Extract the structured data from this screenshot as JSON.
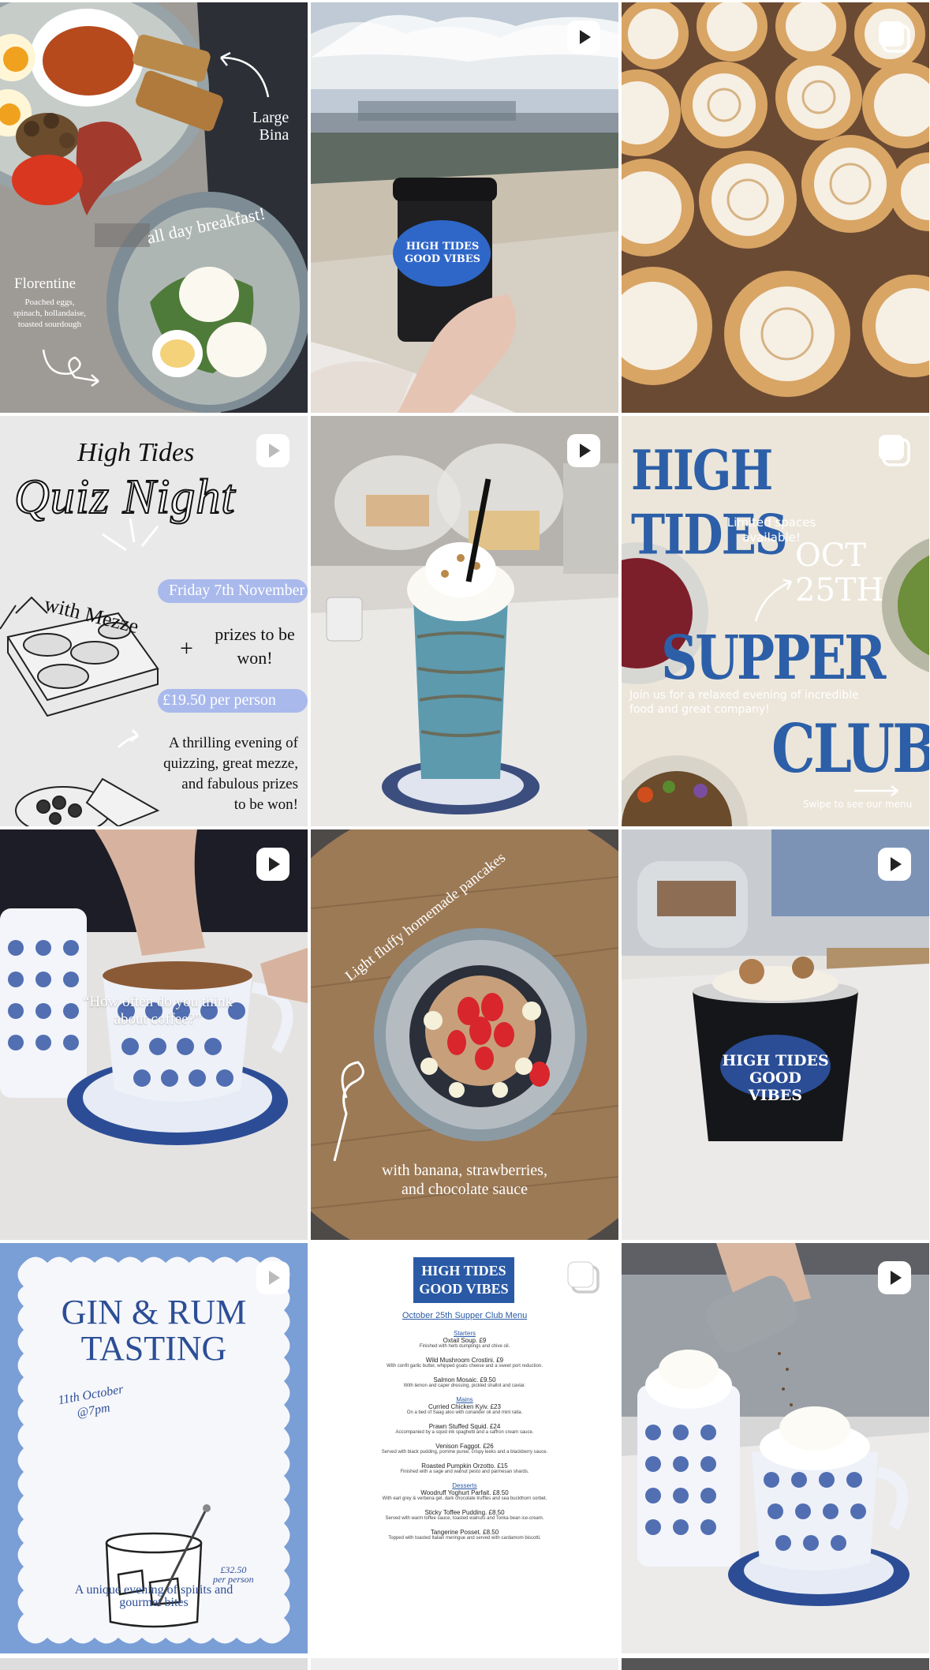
{
  "colors": {
    "brand_blue": "#2c5fa8",
    "cream": "#efe8dc",
    "quiz_bg": "#e9e9e9",
    "gin_bg": "#7a9ed6"
  },
  "posts": [
    {
      "id": "breakfast",
      "type": "carousel-none",
      "texts": {
        "large": "Large",
        "bina": "Bina",
        "all_day": "all day breakfast!",
        "florentine": "Florentine",
        "desc1": "Poached eggs,",
        "desc2": "spinach, hollandaise,",
        "desc3": "toasted sourdough"
      }
    },
    {
      "id": "coffee-cup",
      "type": "reel",
      "icon": "reel-icon",
      "texts": {
        "cup1": "HIGH TIDES",
        "cup2": "GOOD VIBES"
      }
    },
    {
      "id": "meringue-tarts",
      "type": "carousel",
      "icon": "carousel-icon"
    },
    {
      "id": "quiz-night",
      "type": "reel",
      "icon": "reel-icon",
      "texts": {
        "brand": "High Tides",
        "title": "Quiz Night",
        "with_mezze": "with Mezze",
        "date": "Friday 7th November",
        "plus": "+",
        "prizes1": "prizes to be",
        "prizes2": "won!",
        "price": "£19.50 per person",
        "desc1": "A thrilling evening of",
        "desc2": "quizzing, great mezze,",
        "desc3": "and fabulous prizes",
        "desc4": "to be won!"
      }
    },
    {
      "id": "milkshake",
      "type": "reel",
      "icon": "reel-icon"
    },
    {
      "id": "supper-club",
      "type": "carousel",
      "icon": "carousel-icon",
      "texts": {
        "headline": "HIGH TIDES",
        "limited1": "Limited spaces",
        "limited2": "available!",
        "oct": "OCT",
        "day": "25TH",
        "supper": "SUPPER",
        "join1": "Join us for a relaxed evening of incredible",
        "join2": "food and great company!",
        "club": "CLUB",
        "swipe": "Swipe to see our menu"
      }
    },
    {
      "id": "coffee-question",
      "type": "reel",
      "icon": "reel-icon",
      "texts": {
        "quote1": "“How often do you think",
        "quote2": "about coffee?”"
      }
    },
    {
      "id": "pancakes",
      "type": "none",
      "texts": {
        "arc": "Light fluffy homemade pancakes",
        "bottom1": "with banana, strawberries,",
        "bottom2": "and chocolate sauce"
      }
    },
    {
      "id": "ice-cream-cup",
      "type": "reel",
      "icon": "reel-icon",
      "texts": {
        "cup1": "HIGH TIDES",
        "cup2": "GOOD VIBES"
      }
    },
    {
      "id": "gin-rum",
      "type": "reel",
      "icon": "reel-icon",
      "texts": {
        "title1": "GIN & RUM",
        "title2": "TASTING",
        "date1": "11th October",
        "date2": "@7pm",
        "price": "£32.50",
        "per": "per person",
        "bottom1": "A unique evening of spirits and",
        "bottom2": "gourmet bites"
      }
    },
    {
      "id": "supper-menu",
      "type": "carousel",
      "icon": "carousel-icon",
      "texts": {
        "logo1": "HIGH TIDES",
        "logo2": "GOOD VIBES",
        "menu_title": "October 25th Supper Club Menu",
        "starters": "Starters",
        "mains": "Mains",
        "desserts": "Desserts"
      },
      "items": [
        {
          "name": "Oxtail Soup.  £9",
          "desc": "Finished with herb dumplings and chive oil."
        },
        {
          "name": "Wild Mushroom Crostini.  £9",
          "desc": "With confit garlic butter, whipped goats cheese and a sweet port reduction."
        },
        {
          "name": "Salmon Mosaic.  £9.50",
          "desc": "With lemon and caper dressing, pickled shallot and caviar."
        },
        {
          "name": "Curried Chicken Kyiv.  £23",
          "desc": "On a bed of Saag aloo with coriander oil and mint raita."
        },
        {
          "name": "Prawn Stuffed Squid.  £24",
          "desc": "Accompanied by a squid ink spaghetti and a saffron cream sauce."
        },
        {
          "name": "Venison Faggot.  £26",
          "desc": "Served with black pudding, pomme puree, crispy leeks and a blackberry sauce."
        },
        {
          "name": "Roasted Pumpkin Orzotto.  £15",
          "desc": "Finished with a sage and walnut pesto and parmesan shards."
        },
        {
          "name": "Woodruff Yoghurt Parfait.  £8.50",
          "desc": "With earl grey & verbena gel, dark chocolate truffles and sea buckthorn sorbet."
        },
        {
          "name": "Sticky Toffee Pudding.  £8.50",
          "desc": "Served with warm toffee sauce, toasted walnuts and Tonka bean ice-cream."
        },
        {
          "name": "Tangerine Posset.  £8.50",
          "desc": "Topped with toasted Italian meringue and served with cardamom biscotti."
        }
      ]
    },
    {
      "id": "hot-chocolate",
      "type": "reel",
      "icon": "reel-icon"
    }
  ]
}
